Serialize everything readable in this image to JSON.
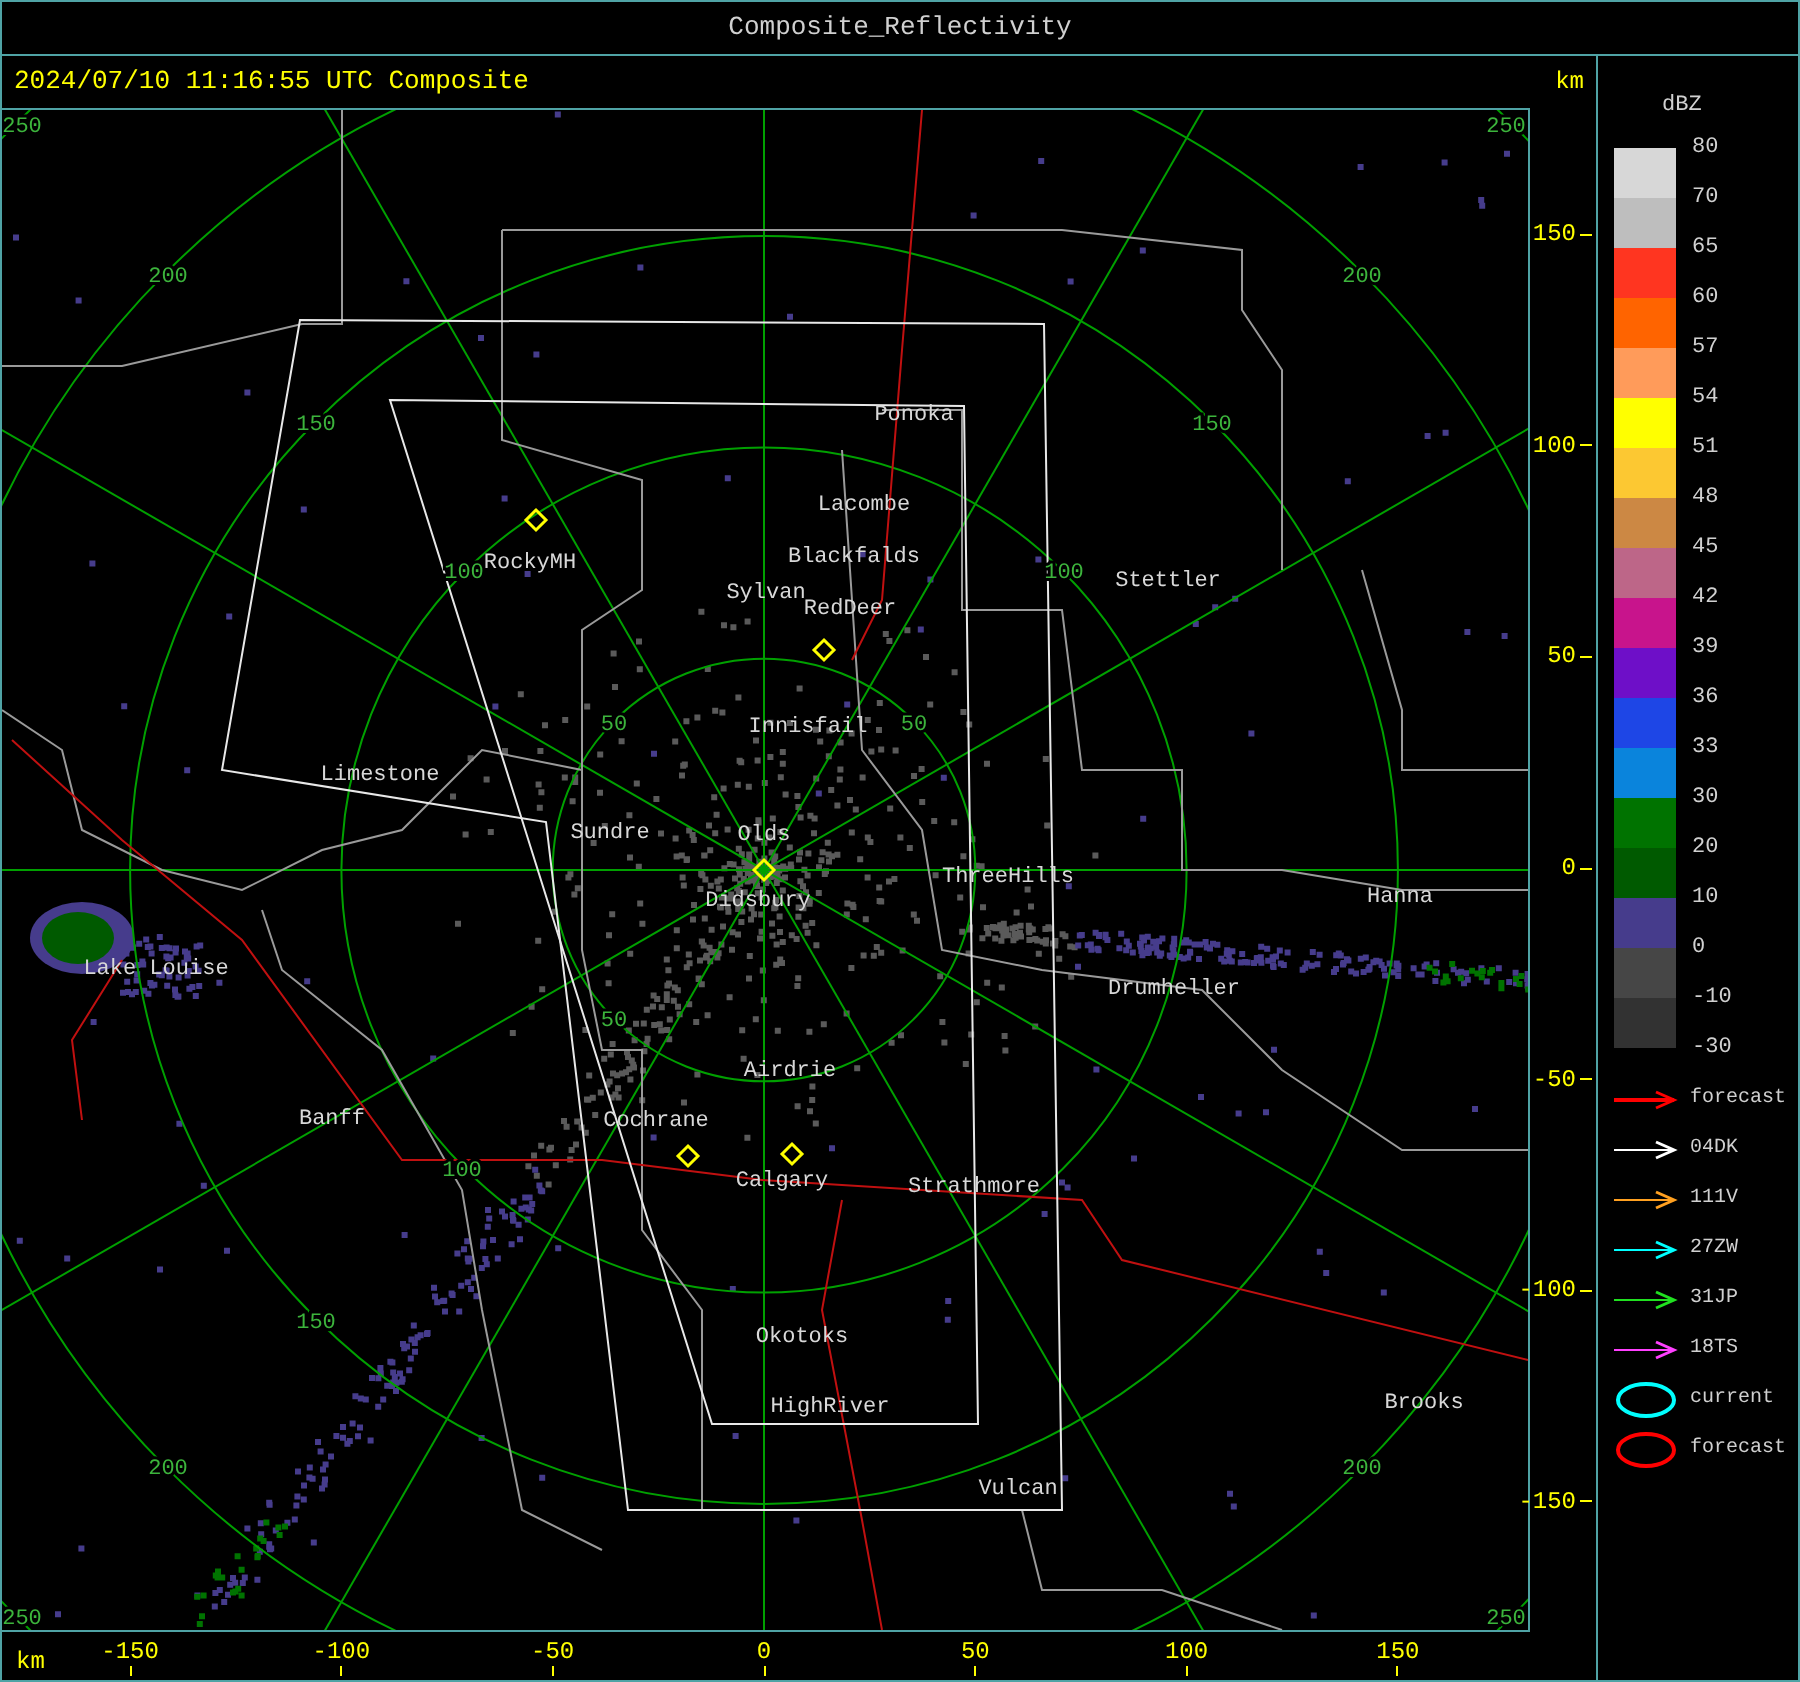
{
  "window": {
    "title": "Composite_Reflectivity"
  },
  "header": {
    "timestamp": "2024/07/10 11:16:55 UTC Composite",
    "unit": "km"
  },
  "ring_labels": [
    {
      "label": "50"
    },
    {
      "label": "50"
    },
    {
      "label": "50"
    },
    {
      "label": "100"
    },
    {
      "label": "100"
    },
    {
      "label": "100"
    },
    {
      "label": "150"
    },
    {
      "label": "150"
    },
    {
      "label": "150"
    },
    {
      "label": "200"
    },
    {
      "label": "200"
    },
    {
      "label": "200"
    },
    {
      "label": "200"
    },
    {
      "label": "250"
    },
    {
      "label": "250"
    },
    {
      "label": "250"
    },
    {
      "label": "250"
    }
  ],
  "towns": [
    {
      "name": "Ponoka"
    },
    {
      "name": "Lacombe"
    },
    {
      "name": "Blackfalds"
    },
    {
      "name": "Sylvan"
    },
    {
      "name": "RedDeer"
    },
    {
      "name": "RockyMH"
    },
    {
      "name": "Stettler"
    },
    {
      "name": "Innisfail"
    },
    {
      "name": "Limestone"
    },
    {
      "name": "Sundre"
    },
    {
      "name": "Olds"
    },
    {
      "name": "Didsbury"
    },
    {
      "name": "ThreeHills"
    },
    {
      "name": "Hanna"
    },
    {
      "name": "Drumheller"
    },
    {
      "name": "Lake Louise"
    },
    {
      "name": "Banff"
    },
    {
      "name": "Airdrie"
    },
    {
      "name": "Cochrane"
    },
    {
      "name": "Calgary"
    },
    {
      "name": "Strathmore"
    },
    {
      "name": "Okotoks"
    },
    {
      "name": "HighRiver"
    },
    {
      "name": "Brooks"
    },
    {
      "name": "Vulcan"
    }
  ],
  "y_axis": {
    "ticks": [
      "150",
      "100",
      "50",
      "0",
      "-50",
      "-100",
      "-150"
    ]
  },
  "x_axis": {
    "unit": "km",
    "ticks": [
      "-150",
      "-100",
      "-50",
      "0",
      "50",
      "100",
      "150"
    ]
  },
  "legend": {
    "title": "dBZ",
    "scale": [
      {
        "label": "80",
        "color": "#d7d7d7"
      },
      {
        "label": "70",
        "color": "#bebebe"
      },
      {
        "label": "65",
        "color": "#ff3520"
      },
      {
        "label": "60",
        "color": "#ff6400"
      },
      {
        "label": "57",
        "color": "#ff9b5a"
      },
      {
        "label": "54",
        "color": "#ffff00"
      },
      {
        "label": "51",
        "color": "#fcc832"
      },
      {
        "label": "48",
        "color": "#cc8844"
      },
      {
        "label": "45",
        "color": "#bd6688"
      },
      {
        "label": "42",
        "color": "#c8148c"
      },
      {
        "label": "39",
        "color": "#6e0fc8"
      },
      {
        "label": "36",
        "color": "#1e46e6"
      },
      {
        "label": "33",
        "color": "#0a84dc"
      },
      {
        "label": "30",
        "color": "#007300"
      },
      {
        "label": "20",
        "color": "#005a00"
      },
      {
        "label": "10",
        "color": "#463c8c"
      },
      {
        "label": "0",
        "color": "#464646"
      },
      {
        "label": "-10",
        "color": "#323232"
      }
    ],
    "bottom_label": "-30"
  },
  "tracks": [
    {
      "kind": "arrow",
      "label": "forecast",
      "color": "#ff0000"
    },
    {
      "kind": "arrow",
      "label": "04DK",
      "color": "#ffffff"
    },
    {
      "kind": "arrow",
      "label": "111V",
      "color": "#ffa020"
    },
    {
      "kind": "arrow",
      "label": "27ZW",
      "color": "#00ffff"
    },
    {
      "kind": "arrow",
      "label": "31JP",
      "color": "#20e020"
    },
    {
      "kind": "arrow",
      "label": "18TS",
      "color": "#ff40ff"
    },
    {
      "kind": "ellipse",
      "label": "current",
      "color": "#00ffff"
    },
    {
      "kind": "ellipse",
      "label": "forecast",
      "color": "#ff0000"
    }
  ]
}
